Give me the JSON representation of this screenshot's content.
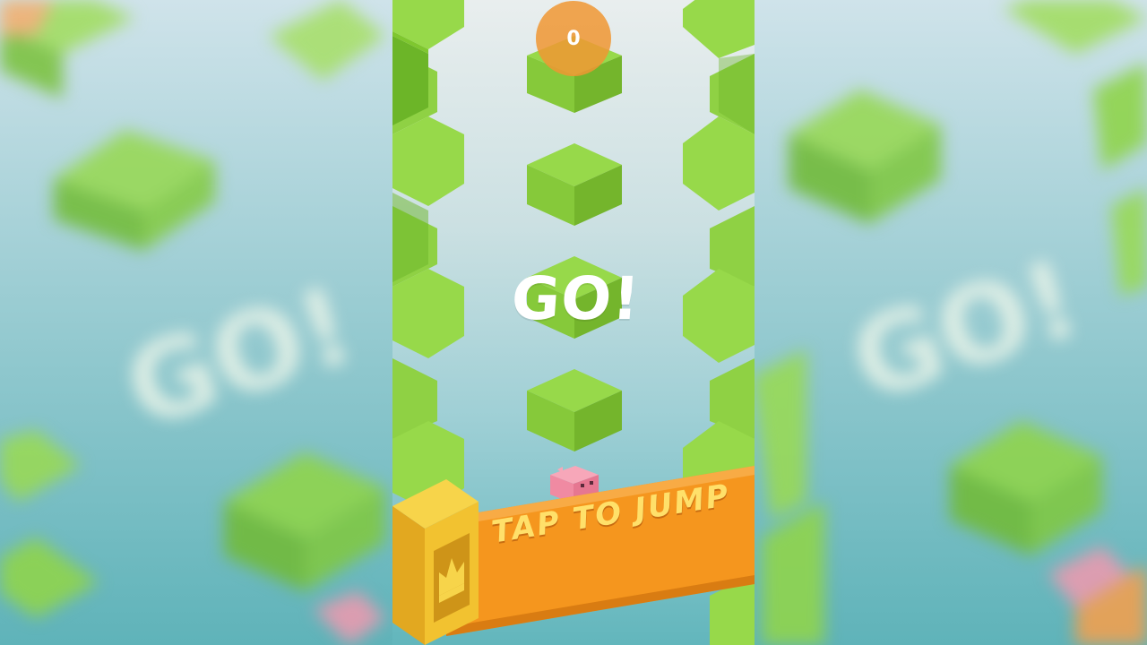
{
  "game": {
    "score": "0",
    "start_message": "GO!",
    "instruction": "TAP TO JUMP"
  },
  "colors": {
    "cube_top": "#97d94a",
    "cube_left": "#7fc72f",
    "cube_right": "#6cb528",
    "accent_orange": "#f5961e",
    "crown_yellow": "#f2c230",
    "pig_pink": "#f08aa2"
  },
  "icons": {
    "crown": "crown-icon",
    "player": "pig-character"
  }
}
